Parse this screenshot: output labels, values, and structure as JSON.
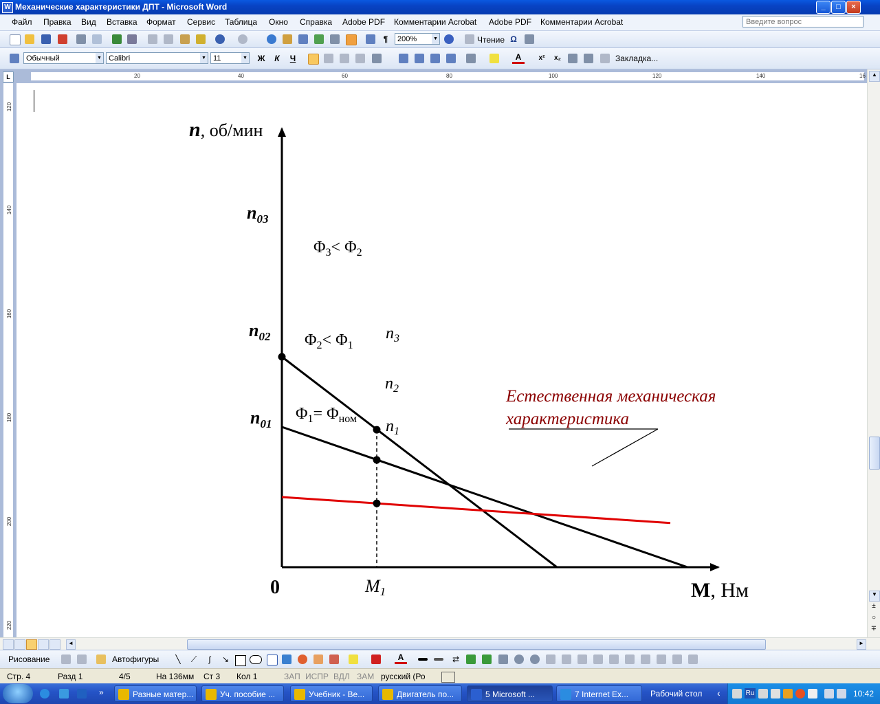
{
  "window": {
    "title": "Механические характеристики ДПТ - Microsoft Word",
    "buttons": [
      "_",
      "□",
      "×"
    ]
  },
  "menu": {
    "items": [
      "Файл",
      "Правка",
      "Вид",
      "Вставка",
      "Формат",
      "Сервис",
      "Таблица",
      "Окно",
      "Справка",
      "Adobe PDF",
      "Комментарии Acrobat",
      "Adobe PDF",
      "Комментарии Acrobat"
    ],
    "ask_placeholder": "Введите вопрос"
  },
  "standard_toolbar": {
    "zoom": "200%",
    "reading_label": "Чтение"
  },
  "format_toolbar": {
    "style": "Обычный",
    "font": "Calibri",
    "size": "11",
    "bold": "Ж",
    "italic": "К",
    "underline": "Ч",
    "bookmark_label": "Закладка..."
  },
  "ruler": {
    "h_marks": [
      "20",
      "40",
      "60",
      "80",
      "100",
      "120",
      "140",
      "16"
    ],
    "v_marks": [
      "120",
      "140",
      "160",
      "180",
      "200",
      "220"
    ],
    "corner": "L"
  },
  "chart_data": {
    "type": "line",
    "y_axis_label_symbol": "n",
    "y_axis_label_unit": ", об/мин",
    "x_axis_label_symbol": "M",
    "x_axis_label_unit": ", Нм",
    "origin_label": "0",
    "x_tick_label": "M",
    "x_tick_sub": "1",
    "y_tick_labels": [
      {
        "main": "n",
        "sub": "03"
      },
      {
        "main": "n",
        "sub": "02"
      },
      {
        "main": "n",
        "sub": "01"
      }
    ],
    "series": [
      {
        "label_main": "Φ",
        "label_sub": "3",
        "label_rest": "< Φ",
        "label_rest_sub": "2",
        "color": "#000000",
        "start": [
          0,
          3.0
        ],
        "end": [
          4.0,
          0
        ]
      },
      {
        "label_main": "Φ",
        "label_sub": "2",
        "label_rest": "< Φ",
        "label_rest_sub": "1",
        "color": "#000000",
        "start": [
          0,
          2.0
        ],
        "end": [
          5.9,
          0
        ]
      },
      {
        "label_main": "Φ",
        "label_sub": "1",
        "label_rest": "= Φ",
        "label_rest_sub": "ном",
        "color": "#e00000",
        "start": [
          0,
          1.0
        ],
        "end": [
          5.65,
          0.63
        ]
      }
    ],
    "points": [
      {
        "main": "n",
        "sub": "3",
        "x": 1.38,
        "y": 1.96
      },
      {
        "main": "n",
        "sub": "2",
        "x": 1.38,
        "y": 1.53
      },
      {
        "main": "n",
        "sub": "1",
        "x": 1.38,
        "y": 0.91
      }
    ],
    "annotation": {
      "line1": "Естественная механическая",
      "line2": "характеристика",
      "color": "#8b0000"
    }
  },
  "draw_toolbar": {
    "draw_label": "Рисование",
    "autoshapes_label": "Автофигуры"
  },
  "status": {
    "page": "Стр. 4",
    "section": "Разд  1",
    "pages": "4/5",
    "at": "На 136мм",
    "line": "Ст 3",
    "col": "Кол 1",
    "rec": "ЗАП",
    "trk": "ИСПР",
    "ext": "ВДЛ",
    "ovr": "ЗАМ",
    "lang": "русский (Ро"
  },
  "taskbar": {
    "buttons": [
      {
        "label": "Разные матер...",
        "color": "#e8b800"
      },
      {
        "label": "Уч. пособие ...",
        "color": "#e8b800"
      },
      {
        "label": "Учебник - Ве...",
        "color": "#e8b800"
      },
      {
        "label": "Двигатель по...",
        "color": "#e8b800"
      },
      {
        "label": "5 Microsoft ...",
        "color": "#2b5fd0"
      },
      {
        "label": "7 Internet Ex...",
        "color": "#2b8ce0"
      }
    ],
    "desktop_label": "Рабочий стол",
    "lang": "Ru",
    "time": "10:42"
  }
}
